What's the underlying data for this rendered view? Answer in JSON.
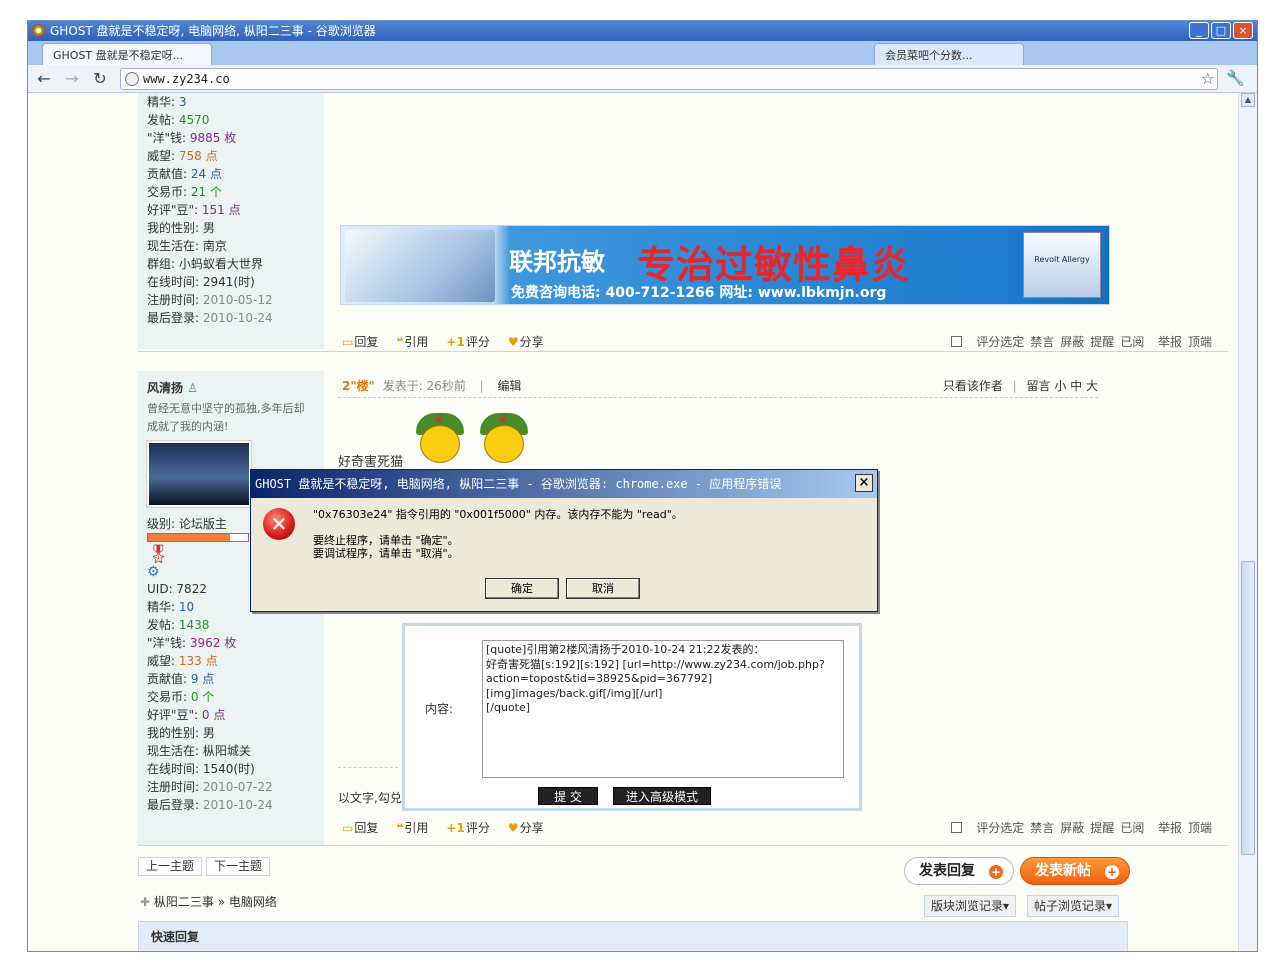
{
  "window": {
    "title": "GHOST 盘就是不稳定呀, 电脑网络, 枞阳二三事 - 谷歌浏览器",
    "tabs": [
      "GHOST 盘就是不稳定呀...",
      "会员菜吧个分数..."
    ],
    "min": "_",
    "max": "□",
    "close": "×"
  },
  "toolbar": {
    "back": "←",
    "forward": "→",
    "reload": "↻",
    "address": "www.zy234.co",
    "star": "☆",
    "wrench": "🔧"
  },
  "post1": {
    "profile": [
      {
        "k": "精华: ",
        "v": "3",
        "c": "b"
      },
      {
        "k": "发帖: ",
        "v": "4570",
        "c": "g"
      },
      {
        "k": "\"洋\"钱: ",
        "v": "9885 枚",
        "c": "p"
      },
      {
        "k": "威望: ",
        "v": "758 点",
        "c": "o"
      },
      {
        "k": "贡献值: ",
        "v": "24 点",
        "c": "b"
      },
      {
        "k": "交易币: ",
        "v": "21 个",
        "c": "g"
      },
      {
        "k": "好评\"豆\": ",
        "v": "151 点",
        "c": "p"
      },
      {
        "k": "我的性别: ",
        "v": "男",
        "c": ""
      },
      {
        "k": "现生活在: ",
        "v": "南京",
        "c": ""
      },
      {
        "k": "群组: ",
        "v": "小蚂蚁看大世界",
        "c": ""
      },
      {
        "k": "在线时间: ",
        "v": "2941(时)",
        "c": ""
      },
      {
        "k": "注册时间: ",
        "v": "2010-05-12",
        "c": "gr"
      },
      {
        "k": "最后登录: ",
        "v": "2010-10-24",
        "c": "gr"
      }
    ],
    "banner": {
      "brand": "联邦抗敏",
      "slogan": "专治过敏性鼻炎",
      "contact": "免费咨询电话: 400-712-1266   网址: www.lbkmjn.org",
      "product": "Revolt Allergy"
    }
  },
  "actions": {
    "reply": "回复",
    "quote": "引用",
    "rate": "评分",
    "share": "分享"
  },
  "rightlinks": [
    "评分选定",
    "禁言",
    "屏蔽",
    "提醒",
    "已阅",
    "举报",
    "顶端"
  ],
  "post2": {
    "author": "风清扬",
    "signature": "曾经无意中坚守的孤独,多年后却成就了我的内涵!",
    "level": "级别: 论坛版主",
    "floor": "2\"楼\"",
    "posted": "发表于: 26秒前",
    "edit": "编辑",
    "only_author": "只看该作者",
    "msg_size": "留言 小 中 大",
    "body": "好奇害死猫",
    "body2": "以文字,勾兑",
    "profile": [
      {
        "k": "UID: ",
        "v": "7822",
        "c": ""
      },
      {
        "k": "精华: ",
        "v": "10",
        "c": "b"
      },
      {
        "k": "发帖: ",
        "v": "1438",
        "c": "g"
      },
      {
        "k": "\"洋\"钱: ",
        "v": "3962 枚",
        "c": "p"
      },
      {
        "k": "威望: ",
        "v": "133 点",
        "c": "o"
      },
      {
        "k": "贡献值: ",
        "v": "9 点",
        "c": "b"
      },
      {
        "k": "交易币: ",
        "v": "0 个",
        "c": "g"
      },
      {
        "k": "好评\"豆\": ",
        "v": "0 点",
        "c": "p"
      },
      {
        "k": "我的性别: ",
        "v": "男",
        "c": ""
      },
      {
        "k": "现生活在: ",
        "v": "枞阳城关",
        "c": ""
      },
      {
        "k": "在线时间: ",
        "v": "1540(时)",
        "c": ""
      },
      {
        "k": "注册时间: ",
        "v": "2010-07-22",
        "c": "gr"
      },
      {
        "k": "最后登录: ",
        "v": "2010-10-24",
        "c": "gr"
      }
    ]
  },
  "quick_reply": {
    "content_label": "内容:",
    "content": "[quote]引用第2楼风清扬于2010-10-24 21:22发表的：\n好奇害死猫[s:192][s:192] [url=http://www.zy234.com/job.php?action=topost&tid=38925&pid=367792][img]images/back.gif[/img][/url]\n[/quote]",
    "submit": "提 交",
    "advanced": "进入高级模式"
  },
  "dialog": {
    "title": "GHOST 盘就是不稳定呀, 电脑网络, 枞阳二三事 - 谷歌浏览器: chrome.exe - 应用程序错误",
    "message": "\"0x76303e24\" 指令引用的 \"0x001f5000\" 内存。该内存不能为 \"read\"。\n\n要终止程序，请单击 \"确定\"。\n要调试程序，请单击 \"取消\"。",
    "ok": "确定",
    "cancel": "取消",
    "close": "×"
  },
  "footer": {
    "prev": "上一主题",
    "next": "下一主题",
    "reply_btn": "发表回复",
    "new_btn": "发表新帖",
    "crumb_home": "枞阳二三事",
    "crumb_sep": "»",
    "crumb_forum": "电脑网络",
    "board_record": "版块浏览记录▾",
    "post_record": "帖子浏览记录▾",
    "quick_reply_title": "快速回复"
  }
}
